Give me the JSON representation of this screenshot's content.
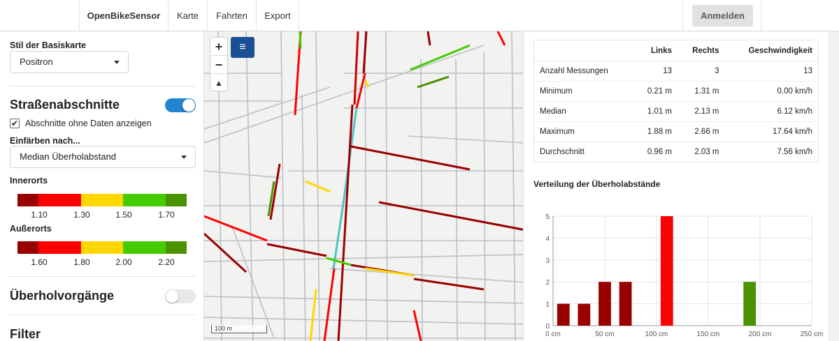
{
  "nav": {
    "brand": "OpenBikeSensor",
    "items": [
      "Karte",
      "Fahrten",
      "Export"
    ],
    "login": "Anmelden"
  },
  "sidebar": {
    "basemap_label": "Stil der Basiskarte",
    "basemap_value": "Positron",
    "segments_heading": "Straßenabschnitte",
    "segments_toggle_on": true,
    "show_empty_label": "Abschnitte ohne Daten anzeigen",
    "show_empty_checked": true,
    "color_by_label": "Einfärben nach...",
    "color_by_value": "Median Überholabstand",
    "innerorts_label": "Innerorts",
    "innerorts_ticks": [
      "1.10",
      "1.30",
      "1.50",
      "1.70"
    ],
    "ausserorts_label": "Außerorts",
    "ausserorts_ticks": [
      "1.60",
      "1.80",
      "2.00",
      "2.20"
    ],
    "scale_colors": [
      "#990000",
      "#ff0000",
      "#ffd700",
      "#44cc00",
      "#4a9200"
    ],
    "overtakes_heading": "Überholvorgänge",
    "overtakes_toggle_on": false,
    "filter_heading": "Filter"
  },
  "map": {
    "zoom_in": "+",
    "zoom_out": "−",
    "reset_north": "▲",
    "layers_icon": "≡",
    "scale_label": "100 m"
  },
  "stats": {
    "headers": [
      "",
      "Links",
      "Rechts",
      "Geschwindigkeit"
    ],
    "rows": [
      [
        "Anzahl Messungen",
        "13",
        "3",
        "13"
      ],
      [
        "Minimum",
        "0.21 m",
        "1.31 m",
        "0.00 km/h"
      ],
      [
        "Median",
        "1.01 m",
        "2.13 m",
        "6.12 km/h"
      ],
      [
        "Maximum",
        "1.88 m",
        "2.66 m",
        "17.64 km/h"
      ],
      [
        "Durchschnitt",
        "0.96 m",
        "2.03 m",
        "7.56 km/h"
      ]
    ]
  },
  "chart_data": {
    "type": "bar",
    "title": "Verteilung der Überholabstände",
    "categories": [
      "0 cm",
      "50 cm",
      "100 cm",
      "150 cm",
      "200 cm",
      "250 cm"
    ],
    "ylim": [
      0,
      5
    ],
    "yticks": [
      "0",
      "1",
      "2",
      "3",
      "4",
      "5"
    ],
    "xlim": [
      0,
      250
    ],
    "bars": [
      {
        "x": 10,
        "value": 1,
        "color": "#990000"
      },
      {
        "x": 30,
        "value": 1,
        "color": "#990000"
      },
      {
        "x": 50,
        "value": 2,
        "color": "#990000"
      },
      {
        "x": 70,
        "value": 2,
        "color": "#990000"
      },
      {
        "x": 110,
        "value": 5,
        "color": "#ff0000"
      },
      {
        "x": 190,
        "value": 2,
        "color": "#4a9200"
      }
    ]
  }
}
